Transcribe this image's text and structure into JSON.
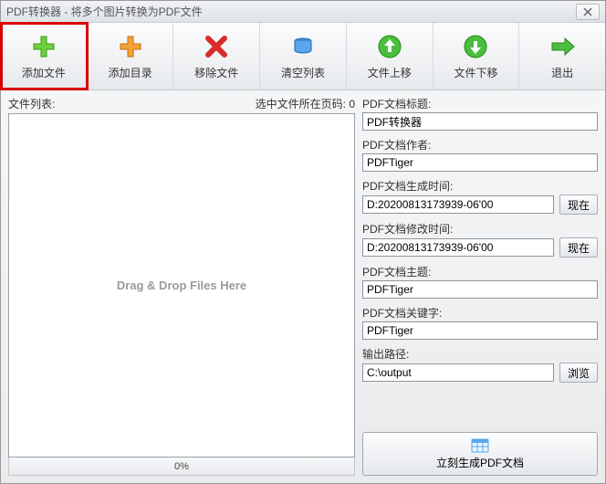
{
  "window": {
    "title": "PDF转换器 - 将多个图片转换为PDF文件"
  },
  "toolbar": {
    "add_file": "添加文件",
    "add_dir": "添加目录",
    "remove_file": "移除文件",
    "clear_list": "清空列表",
    "file_up": "文件上移",
    "file_down": "文件下移",
    "exit": "退出"
  },
  "left": {
    "list_label": "文件列表:",
    "page_label": "选中文件所在页码: 0",
    "drop_hint": "Drag & Drop Files Here",
    "progress": "0%"
  },
  "fields": {
    "title_label": "PDF文档标题:",
    "title_value": "PDF转换器",
    "author_label": "PDF文档作者:",
    "author_value": "PDFTiger",
    "created_label": "PDF文档生成时间:",
    "created_value": "D:20200813173939-06'00",
    "modified_label": "PDF文档修改时间:",
    "modified_value": "D:20200813173939-06'00",
    "subject_label": "PDF文档主题:",
    "subject_value": "PDFTiger",
    "keywords_label": "PDF文档关键字:",
    "keywords_value": "PDFTiger",
    "output_label": "输出路径:",
    "output_value": "C:\\output",
    "now_btn": "现在",
    "browse_btn": "浏览"
  },
  "generate": {
    "label": "立刻生成PDF文档"
  }
}
